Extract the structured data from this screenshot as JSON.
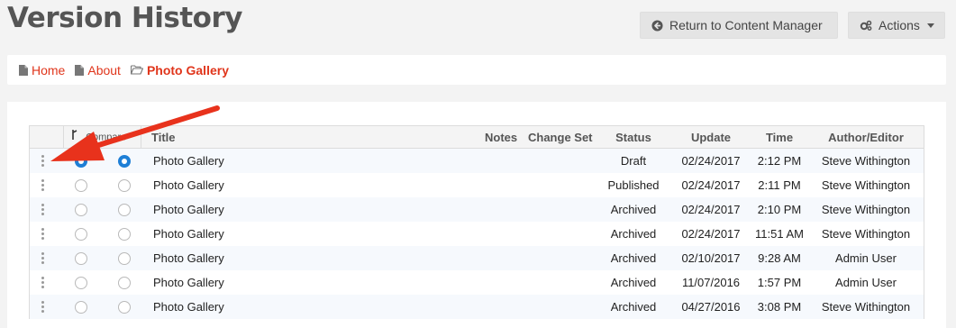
{
  "page": {
    "title": "Version History"
  },
  "toolbar": {
    "return_label": "Return to Content Manager",
    "actions_label": "Actions",
    "return_icon": "arrow-circle-left-icon",
    "actions_icon": "cogs-icon"
  },
  "breadcrumb": [
    {
      "label": "Home",
      "icon": "file-icon"
    },
    {
      "label": "About",
      "icon": "file-icon"
    },
    {
      "label": "Photo Gallery",
      "icon": "folder-open-icon",
      "current": true
    }
  ],
  "table": {
    "headers": {
      "compare": "Compare",
      "title": "Title",
      "notes": "Notes",
      "change_set": "Change Set",
      "status": "Status",
      "update": "Update",
      "time": "Time",
      "author": "Author/Editor"
    },
    "rows": [
      {
        "title": "Photo Gallery",
        "status": "Draft",
        "update": "02/24/2017",
        "time": "2:12 PM",
        "author": "Steve Withington",
        "compare_a": true,
        "compare_b": true
      },
      {
        "title": "Photo Gallery",
        "status": "Published",
        "update": "02/24/2017",
        "time": "2:11 PM",
        "author": "Steve Withington",
        "compare_a": false,
        "compare_b": false
      },
      {
        "title": "Photo Gallery",
        "status": "Archived",
        "update": "02/24/2017",
        "time": "2:10 PM",
        "author": "Steve Withington",
        "compare_a": false,
        "compare_b": false
      },
      {
        "title": "Photo Gallery",
        "status": "Archived",
        "update": "02/24/2017",
        "time": "11:51 AM",
        "author": "Steve Withington",
        "compare_a": false,
        "compare_b": false
      },
      {
        "title": "Photo Gallery",
        "status": "Archived",
        "update": "02/10/2017",
        "time": "9:28 AM",
        "author": "Admin User",
        "compare_a": false,
        "compare_b": false
      },
      {
        "title": "Photo Gallery",
        "status": "Archived",
        "update": "11/07/2016",
        "time": "1:57 PM",
        "author": "Admin User",
        "compare_a": false,
        "compare_b": false
      },
      {
        "title": "Photo Gallery",
        "status": "Archived",
        "update": "04/27/2016",
        "time": "3:08 PM",
        "author": "Steve Withington",
        "compare_a": false,
        "compare_b": false
      }
    ]
  },
  "colors": {
    "accent_red": "#e0351b",
    "radio_blue": "#1e7fd6",
    "annotation_arrow": "#e8321c"
  }
}
